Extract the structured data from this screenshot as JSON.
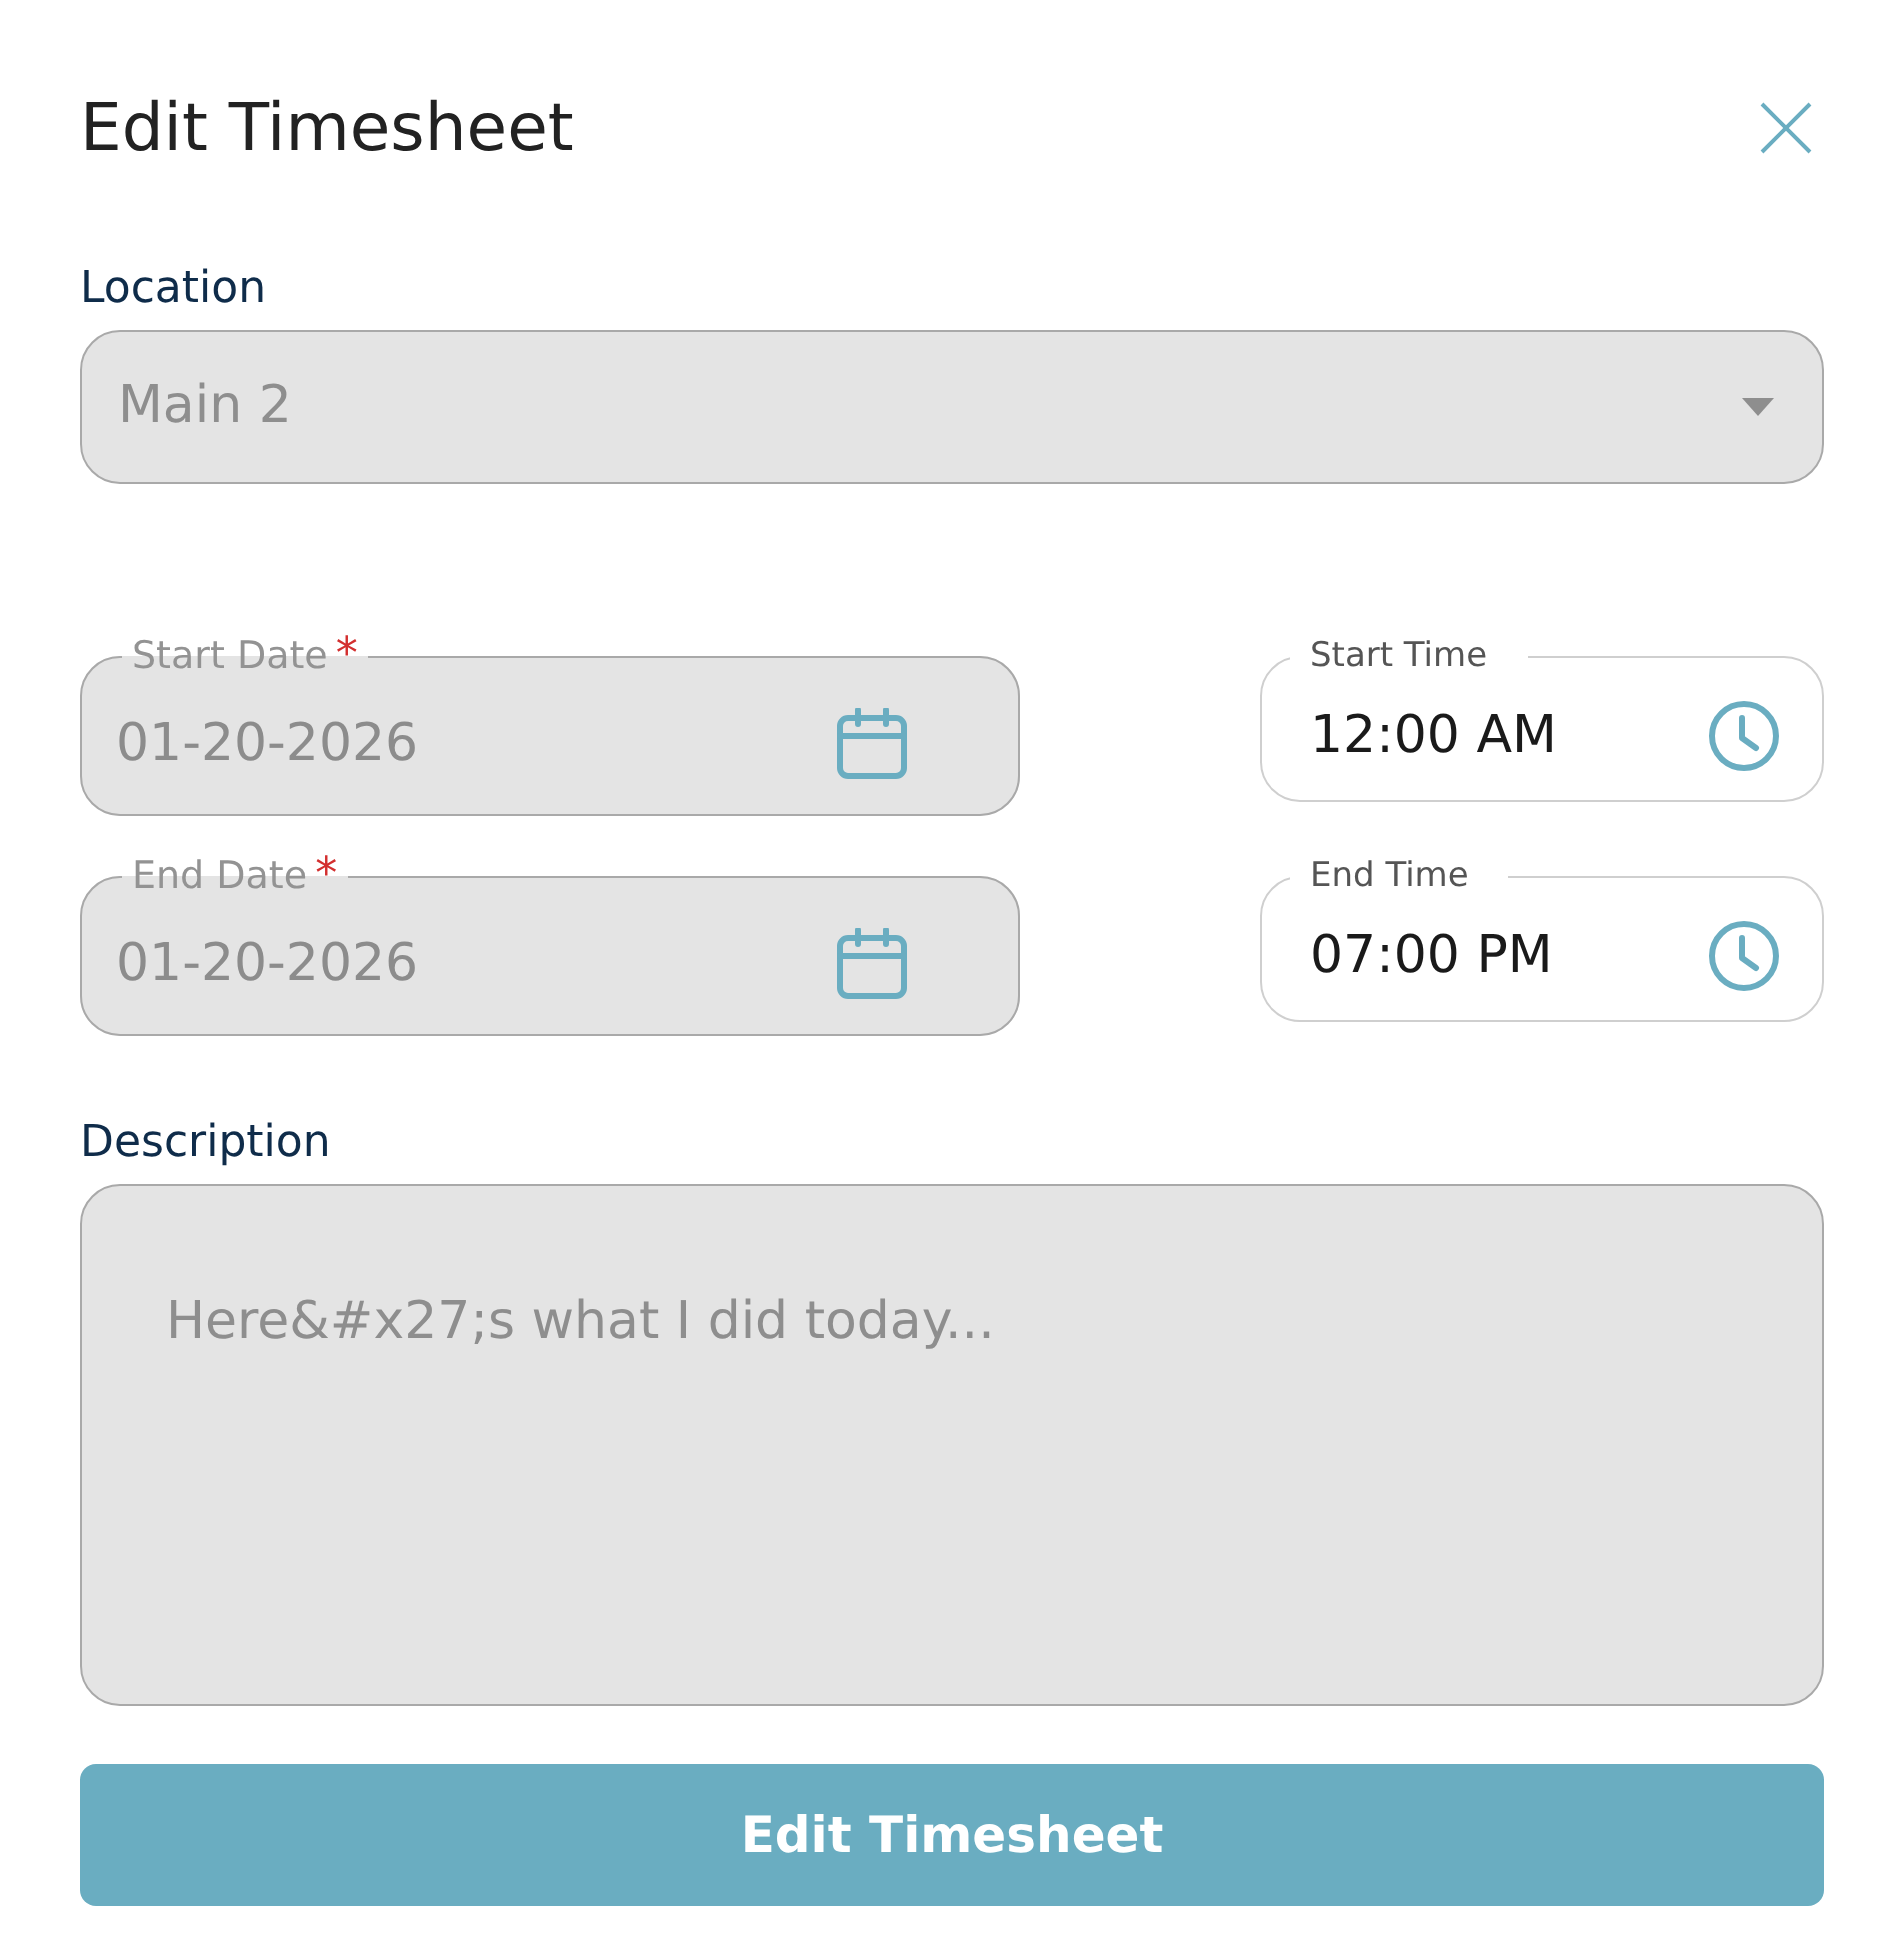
{
  "dialog": {
    "title": "Edit Timesheet"
  },
  "location": {
    "label": "Location",
    "value": "Main 2",
    "disabled": true
  },
  "schedule_rows": [
    {
      "date": {
        "label": "Start Date",
        "required_mark": "*",
        "value": "01-20-2026",
        "disabled": true
      },
      "time": {
        "label": "Start Time",
        "value": "12:00 AM",
        "disabled": false
      }
    },
    {
      "date": {
        "label": "End Date",
        "required_mark": "*",
        "value": "01-20-2026",
        "disabled": true
      },
      "time": {
        "label": "End Time",
        "value": "07:00 PM",
        "disabled": false
      }
    }
  ],
  "description": {
    "label": "Description",
    "placeholder": "Here&#x27;s what I did today...",
    "disabled": true
  },
  "submit_button": {
    "label": "Edit Timesheet"
  }
}
